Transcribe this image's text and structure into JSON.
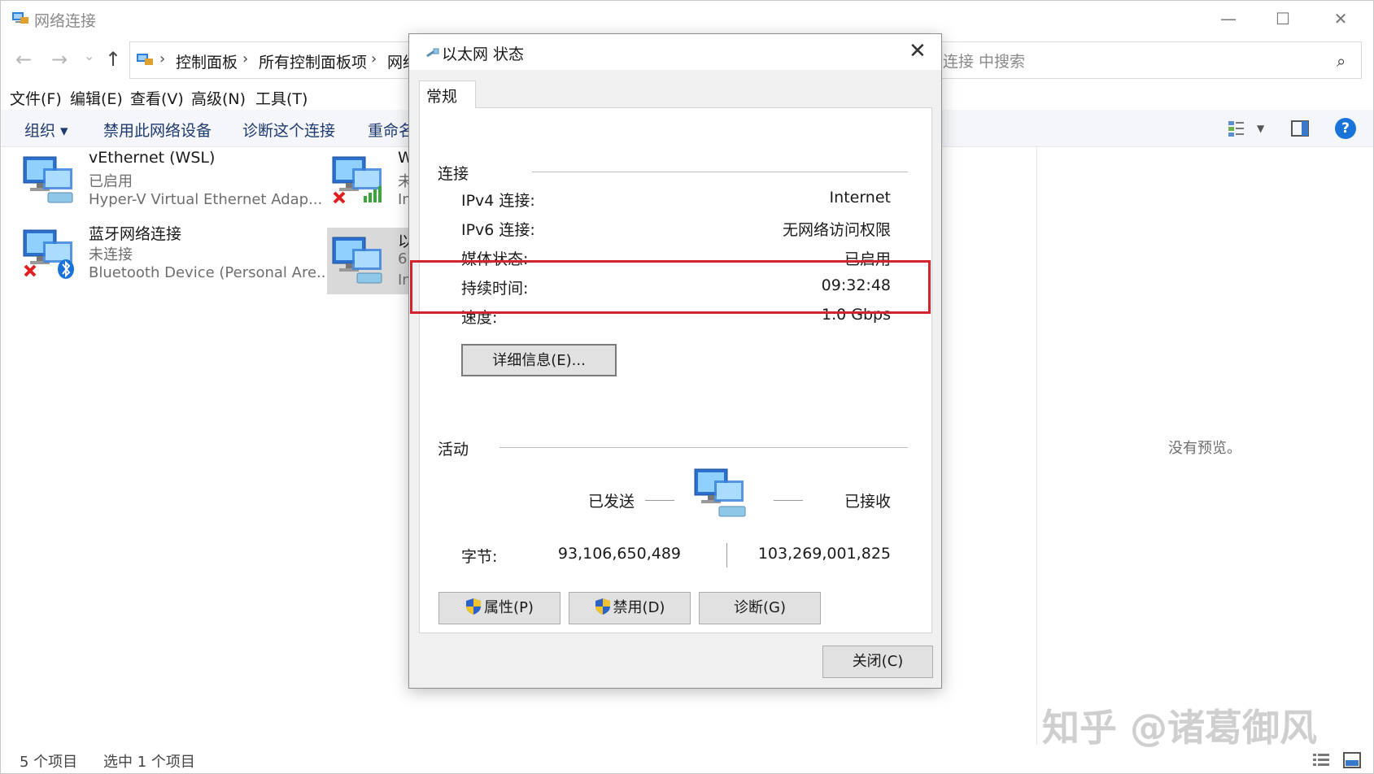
{
  "explorer": {
    "title": "网络连接",
    "window_controls": {
      "minimize": "—",
      "maximize": "☐",
      "close": "✕"
    },
    "nav": {
      "back": "←",
      "forward": "→",
      "recent": "⌄",
      "up": "↑"
    },
    "breadcrumb": [
      "控制面板",
      "所有控制面板项",
      "网络"
    ],
    "search_placeholder": "连接 中搜索",
    "menu": [
      "文件(F)",
      "编辑(E)",
      "查看(V)",
      "高级(N)",
      "工具(T)"
    ],
    "commands": {
      "organize": "组织 ▾",
      "disable": "禁用此网络设备",
      "diagnose": "诊断这个连接",
      "rename": "重命名"
    },
    "items": [
      {
        "name": "vEthernet (WSL)",
        "status": "已启用",
        "device": "Hyper-V Virtual Ethernet Adap...",
        "icon": "ethernet-adapter-icon"
      },
      {
        "name": "W",
        "status": "未",
        "device": "In",
        "icon": "wifi-adapter-icon"
      },
      {
        "name": "蓝牙网络连接",
        "status": "未连接",
        "device": "Bluetooth Device (Personal Are...",
        "icon": "bluetooth-adapter-icon"
      },
      {
        "name": "以",
        "status": "6",
        "device": "In",
        "icon": "ethernet-adapter-icon"
      }
    ],
    "preview_text": "没有预览。",
    "status_count": "5 个项目",
    "status_selected": "选中 1 个项目",
    "watermark": "知乎 @诸葛御风"
  },
  "dialog": {
    "title": "以太网 状态",
    "close_glyph": "✕",
    "tab": "常规",
    "connection_group": "连接",
    "rows": [
      {
        "label": "IPv4 连接:",
        "value": "Internet"
      },
      {
        "label": "IPv6 连接:",
        "value": "无网络访问权限"
      },
      {
        "label": "媒体状态:",
        "value": "已启用"
      },
      {
        "label": "持续时间:",
        "value": "09:32:48"
      },
      {
        "label": "速度:",
        "value": "1.0 Gbps"
      }
    ],
    "details_button": "详细信息(E)...",
    "activity_group": "活动",
    "sent_label": "已发送",
    "received_label": "已接收",
    "bytes_label": "字节:",
    "bytes_sent": "93,106,650,489",
    "bytes_received": "103,269,001,825",
    "properties_button": "属性(P)",
    "disable_button": "禁用(D)",
    "diagnose_button": "诊断(G)",
    "close_button": "关闭(C)"
  },
  "colors": {
    "highlight": "#d3232e",
    "command_text": "#1f3a70",
    "help_blue": "#1a73d9"
  }
}
